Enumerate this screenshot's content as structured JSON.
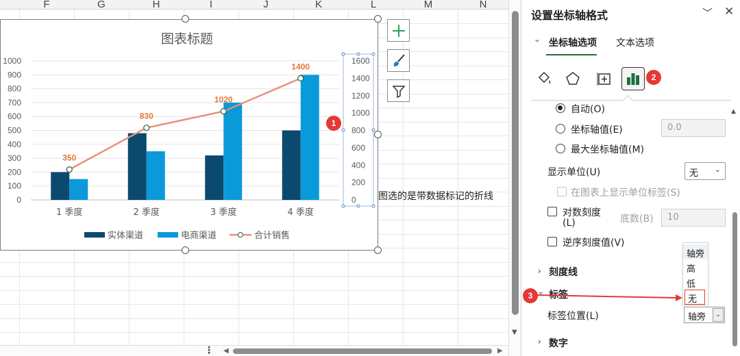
{
  "sheet": {
    "columns": [
      "F",
      "G",
      "H",
      "I",
      "J",
      "K",
      "L",
      "M",
      "N"
    ],
    "cell_text": "图选的是带数据标记的折线"
  },
  "chart": {
    "title": "图表标题",
    "legend": [
      "实体渠道",
      "电商渠道",
      "合计销售"
    ]
  },
  "chart_data": {
    "type": "bar",
    "title": "图表标题",
    "categories": [
      "1 季度",
      "2 季度",
      "3 季度",
      "4 季度"
    ],
    "series": [
      {
        "name": "实体渠道",
        "type": "bar",
        "axis": "left",
        "values": [
          200,
          480,
          320,
          500
        ],
        "color": "#0b4a6e"
      },
      {
        "name": "电商渠道",
        "type": "bar",
        "axis": "left",
        "values": [
          150,
          350,
          700,
          900
        ],
        "color": "#0a9ad9"
      },
      {
        "name": "合计销售",
        "type": "line",
        "axis": "right",
        "values": [
          350,
          830,
          1020,
          1400
        ],
        "color": "#e8907a",
        "data_labels": [
          "350",
          "830",
          "1020",
          "1400"
        ],
        "label_color": "#e07b39"
      }
    ],
    "left_axis": {
      "ylim": [
        0,
        1000
      ],
      "ticks": [
        "0",
        "100",
        "200",
        "300",
        "400",
        "500",
        "600",
        "700",
        "800",
        "900",
        "1000"
      ]
    },
    "right_axis": {
      "ylim": [
        0,
        1600
      ],
      "ticks": [
        "0",
        "200",
        "400",
        "600",
        "800",
        "1000",
        "1200",
        "1400",
        "1600"
      ]
    },
    "grid": true,
    "legend_position": "bottom"
  },
  "chart_buttons": [
    "chart-elements-button",
    "chart-styles-button",
    "chart-filters-button"
  ],
  "pane": {
    "title": "设置坐标轴格式",
    "tabs": [
      "坐标轴选项",
      "文本选项"
    ],
    "badges": [
      "1",
      "2",
      "3"
    ],
    "radios": [
      {
        "label": "自动(O)",
        "checked": true
      },
      {
        "label": "坐标轴值(E)",
        "checked": false,
        "value": "0.0"
      },
      {
        "label": "最大坐标轴值(M)",
        "checked": false
      }
    ],
    "display_unit_label": "显示单位(U)",
    "display_unit_value": "无",
    "show_unit_label": "在图表上显示单位标签(S)",
    "log_scale_label": "对数刻度",
    "log_scale_label2": "(L)",
    "log_base_label": "底数(B)",
    "log_base_value": "10",
    "reverse_label": "逆序刻度值(V)",
    "sections": [
      "刻度线",
      "标签",
      "数字"
    ],
    "label_position_label": "标签位置(L)",
    "label_position_value": "轴旁",
    "dropdown_options": [
      "轴旁",
      "高",
      "低",
      "无"
    ]
  },
  "colors": {
    "accent_green": "#1d6f3b",
    "badge_red": "#e53935",
    "arrow_red": "#e53935"
  }
}
